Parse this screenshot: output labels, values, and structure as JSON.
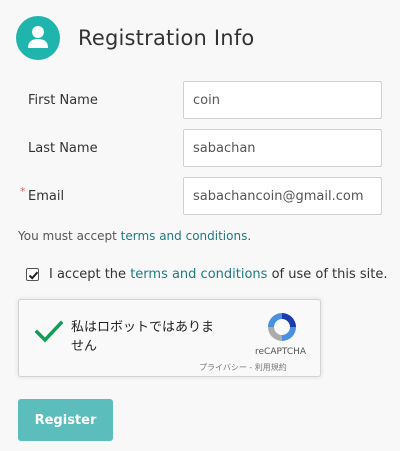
{
  "header": {
    "title": "Registration Info",
    "icon": "user-icon",
    "accent": "#1fb5ad"
  },
  "form": {
    "first_name": {
      "label": "First Name",
      "value": "coin"
    },
    "last_name": {
      "label": "Last Name",
      "value": "sabachan"
    },
    "email": {
      "label": "Email",
      "required_mark": "*",
      "value": "sabachancoin@gmail.com"
    }
  },
  "terms_note": {
    "prefix": "You must accept ",
    "link": "terms and conditions",
    "suffix": "."
  },
  "accept": {
    "checked": true,
    "prefix": "I accept the ",
    "link": "terms and conditions",
    "suffix": " of use of this site."
  },
  "captcha": {
    "text": "私はロボットではありません",
    "brand": "reCAPTCHA",
    "links": "プライバシー - 利用規約",
    "verified": true
  },
  "register_button": {
    "label": "Register",
    "color": "#5bbdbc"
  }
}
